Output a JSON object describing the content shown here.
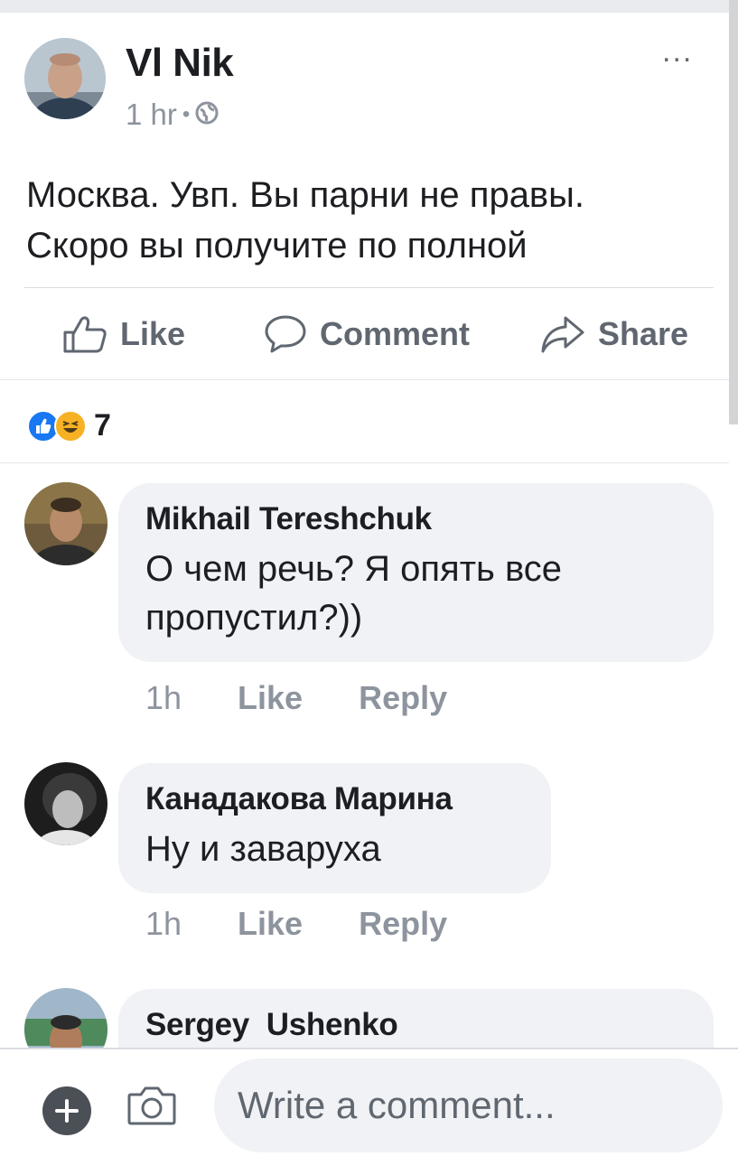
{
  "post": {
    "author": "Vl Nik",
    "time": "1 hr",
    "separator": "•",
    "privacy_icon": "globe-icon",
    "more_label": "...",
    "text_line1": "Москва. Увп. Вы парни не правы.",
    "text_line2": "Скоро вы получите по полной"
  },
  "actions": {
    "like": "Like",
    "comment": "Comment",
    "share": "Share"
  },
  "reactions": {
    "icons": [
      "like-reaction-icon",
      "haha-reaction-icon"
    ],
    "count": "7"
  },
  "comments": [
    {
      "name": "Mikhail Tereshchuk",
      "text_line1": "О чем речь? Я опять все",
      "text_line2": "пропустил?))",
      "time": "1h",
      "like": "Like",
      "reply": "Reply"
    },
    {
      "name": "Канадакова Марина",
      "text_line1": "Ну и заваруха",
      "time": "1h",
      "like": "Like",
      "reply": "Reply"
    },
    {
      "name": "Sergey  Ushenko"
    }
  ],
  "composer": {
    "placeholder": "Write a comment...",
    "plus_icon": "plus-icon",
    "camera_icon": "camera-icon"
  },
  "colors": {
    "bubble": "#f0f2f5",
    "meta": "#8d949e",
    "action": "#606770",
    "like_reaction": "#1877f2",
    "haha_reaction": "#f7b125"
  }
}
